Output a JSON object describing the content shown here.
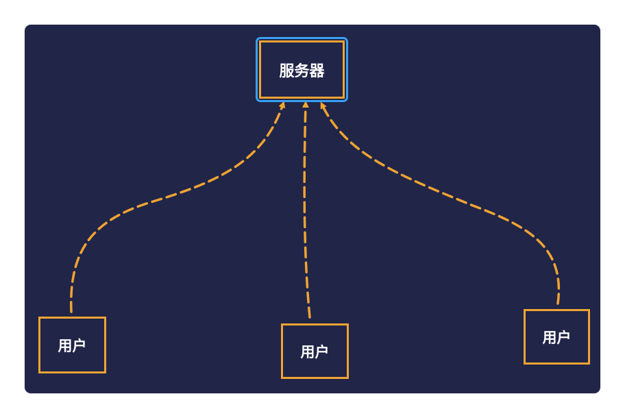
{
  "diagram": {
    "server": {
      "label": "服务器"
    },
    "users": [
      {
        "label": "用户"
      },
      {
        "label": "用户"
      },
      {
        "label": "用户"
      }
    ],
    "colors": {
      "background": "#212548",
      "node_border": "#f0a433",
      "server_highlight": "#3aa0f0",
      "connector": "#f0a433",
      "text": "#ffffff"
    },
    "connector_style": "dashed arrow from each user to server"
  }
}
